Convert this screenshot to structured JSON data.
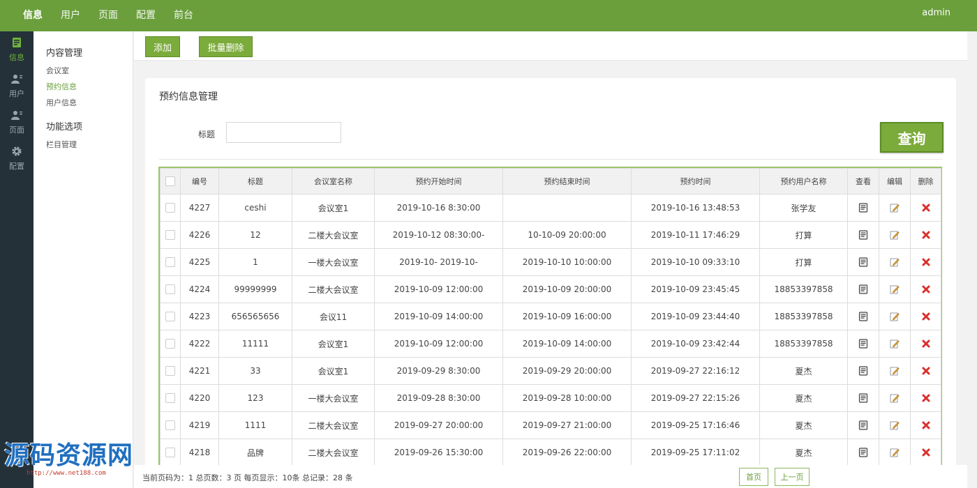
{
  "topnav": {
    "items": [
      "信息",
      "用户",
      "页面",
      "配置",
      "前台"
    ],
    "user": "admin"
  },
  "rail": {
    "items": [
      {
        "label": "信息",
        "icon": "info-icon"
      },
      {
        "label": "用户",
        "icon": "user-icon"
      },
      {
        "label": "页面",
        "icon": "page-icon"
      },
      {
        "label": "配置",
        "icon": "gear-icon"
      }
    ]
  },
  "submenu": {
    "group1": "内容管理",
    "links1": [
      "会议室",
      "预约信息",
      "用户信息"
    ],
    "group2": "功能选项",
    "links2": [
      "栏目管理"
    ]
  },
  "toolbar": {
    "add_label": "添加",
    "batch_delete_label": "批量删除"
  },
  "panel": {
    "title": "预约信息管理",
    "search_label": "标题",
    "search_value": "",
    "query_label": "查询"
  },
  "table": {
    "headers": [
      "",
      "编号",
      "标题",
      "会议室名称",
      "预约开始时间",
      "预约结束时间",
      "预约时间",
      "预约用户名称",
      "查看",
      "编辑",
      "删除"
    ],
    "rows": [
      [
        "4227",
        "ceshi",
        "会议室1",
        "2019-10-16 8:30:00",
        "",
        "2019-10-16 13:48:53",
        "张学友"
      ],
      [
        "4226",
        "12",
        "二楼大会议室",
        "2019-10-12 08:30:00-",
        "10-10-09 20:00:00",
        "2019-10-11 17:46:29",
        "打算"
      ],
      [
        "4225",
        "1",
        "一楼大会议室",
        "2019-10-    2019-10-",
        "2019-10-10 10:00:00",
        "2019-10-10 09:33:10",
        "打算"
      ],
      [
        "4224",
        "99999999",
        "二楼大会议室",
        "2019-10-09 12:00:00",
        "2019-10-09 20:00:00",
        "2019-10-09 23:45:45",
        "18853397858"
      ],
      [
        "4223",
        "656565656",
        "会议11",
        "2019-10-09 14:00:00",
        "2019-10-09 16:00:00",
        "2019-10-09 23:44:40",
        "18853397858"
      ],
      [
        "4222",
        "11111",
        "会议室1",
        "2019-10-09 12:00:00",
        "2019-10-09 14:00:00",
        "2019-10-09 23:42:44",
        "18853397858"
      ],
      [
        "4221",
        "33",
        "会议室1",
        "2019-09-29 8:30:00",
        "2019-09-29 20:00:00",
        "2019-09-27 22:16:12",
        "夏杰"
      ],
      [
        "4220",
        "123",
        "一楼大会议室",
        "2019-09-28 8:30:00",
        "2019-09-28 10:00:00",
        "2019-09-27 22:15:26",
        "夏杰"
      ],
      [
        "4219",
        "1111",
        "二楼大会议室",
        "2019-09-27 20:00:00",
        "2019-09-27 21:00:00",
        "2019-09-25 17:16:46",
        "夏杰"
      ],
      [
        "4218",
        "品牌",
        "二楼大会议室",
        "2019-09-26 15:30:00",
        "2019-09-26 22:00:00",
        "2019-09-25 17:11:02",
        "夏杰"
      ]
    ]
  },
  "pager": {
    "info": "当前页码为：1 总页数：3 页 每页显示：10条 总记录：28 条",
    "first_label": "首页",
    "prev_label": "上一页"
  },
  "watermark": {
    "text": "源码资源网",
    "url": "http://www.net188.com"
  },
  "colors": {
    "brand": "#6a9f3c",
    "button": "#7bab3a",
    "rail": "#253139",
    "delete": "#d9302c"
  }
}
